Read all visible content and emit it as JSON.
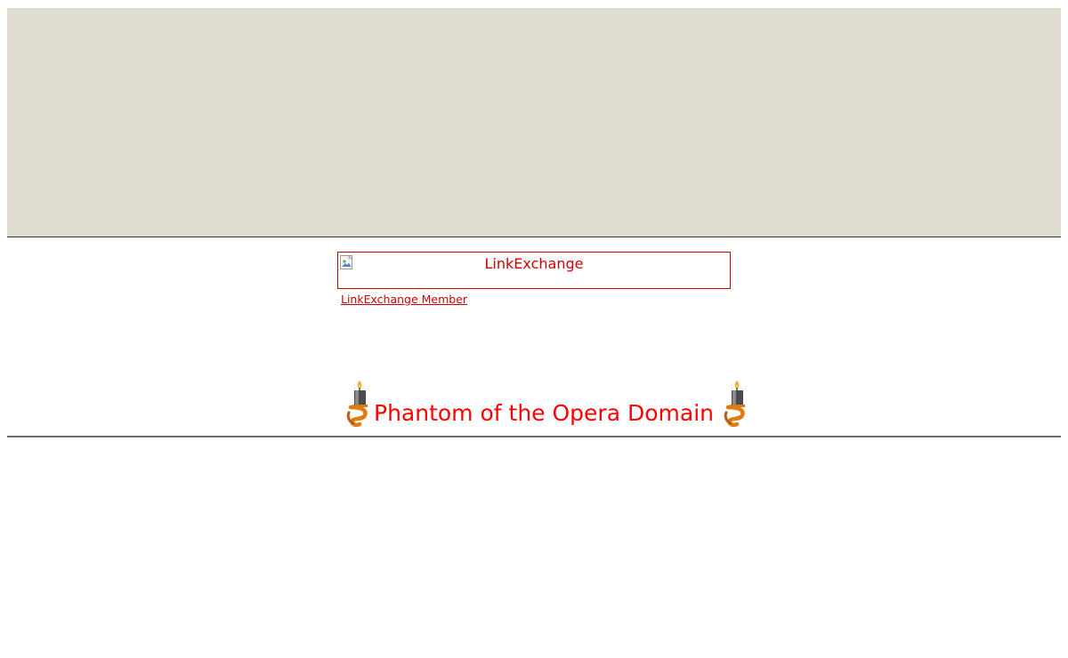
{
  "banner": {
    "alt_text": "LinkExchange",
    "member_link": "LinkExchange Member"
  },
  "header": {
    "title": "Phantom of the Opera Domain"
  },
  "colors": {
    "top_panel": "#dfdbd0",
    "link_red": "#cc0000",
    "title_red": "#ff0000"
  },
  "icons": {
    "candle_left": "candle-icon",
    "candle_right": "candle-icon",
    "broken_image": "broken-image-icon"
  }
}
